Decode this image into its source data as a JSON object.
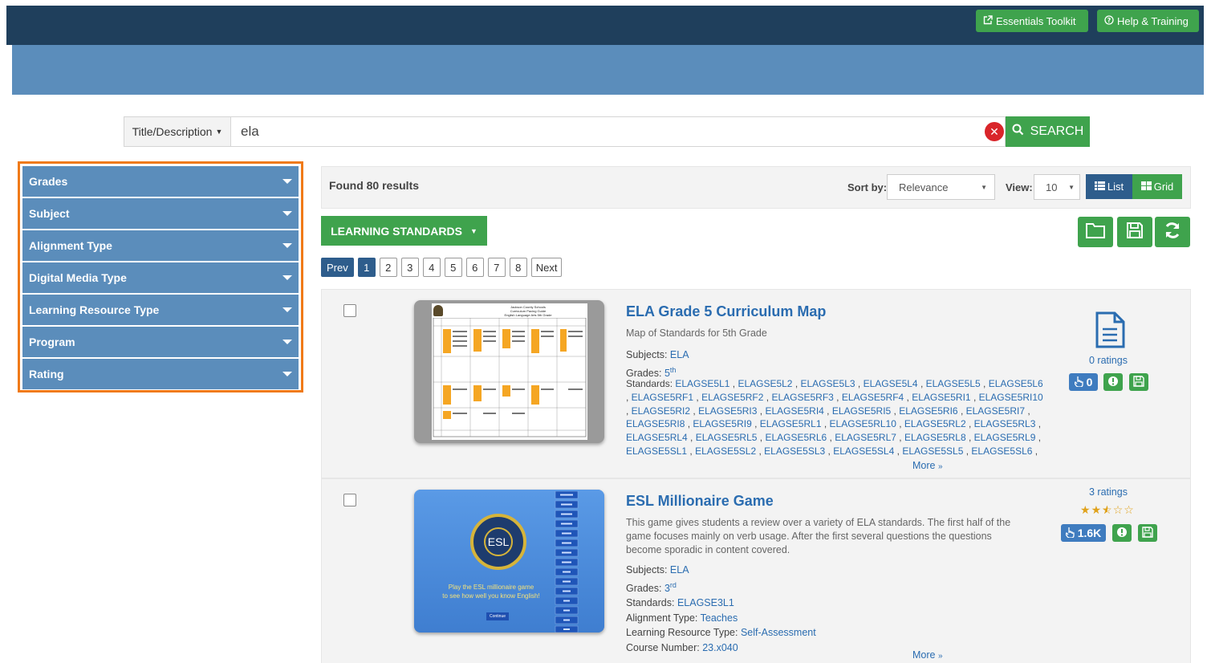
{
  "topbar": {
    "essentials_label": "Essentials Toolkit",
    "help_label": "Help & Training"
  },
  "search": {
    "field_label": "Title/Description",
    "query": "ela",
    "button_label": "SEARCH"
  },
  "filters": [
    "Grades",
    "Subject",
    "Alignment Type",
    "Digital Media Type",
    "Learning Resource Type",
    "Program",
    "Rating"
  ],
  "results": {
    "found_label": "Found 80 results",
    "sort_label": "Sort by:",
    "sort_value": "Relevance",
    "view_label": "View:",
    "view_value": "10",
    "list_label": "List",
    "grid_label": "Grid",
    "standards_button": "LEARNING STANDARDS"
  },
  "pagination": {
    "prev": "Prev",
    "pages": [
      "1",
      "2",
      "3",
      "4",
      "5",
      "6",
      "7",
      "8"
    ],
    "active": "1",
    "next": "Next"
  },
  "items": [
    {
      "title": "ELA Grade 5 Curriculum Map",
      "description": "Map of Standards for 5th Grade",
      "subjects_label": "Subjects:",
      "subjects": "ELA",
      "grades_label": "Grades:",
      "grade_num": "5",
      "grade_sup": "th",
      "standards_label": "Standards:",
      "standards": [
        "ELAGSE5L1",
        "ELAGSE5L2",
        "ELAGSE5L3",
        "ELAGSE5L4",
        "ELAGSE5L5",
        "ELAGSE5L6",
        "ELAGSE5RF1",
        "ELAGSE5RF2",
        "ELAGSE5RF3",
        "ELAGSE5RF4",
        "ELAGSE5RI1",
        "ELAGSE5RI10",
        "ELAGSE5RI2",
        "ELAGSE5RI3",
        "ELAGSE5RI4",
        "ELAGSE5RI5",
        "ELAGSE5RI6",
        "ELAGSE5RI7",
        "ELAGSE5RI8",
        "ELAGSE5RI9",
        "ELAGSE5RL1",
        "ELAGSE5RL10",
        "ELAGSE5RL2",
        "ELAGSE5RL3",
        "ELAGSE5RL4",
        "ELAGSE5RL5",
        "ELAGSE5RL6",
        "ELAGSE5RL7",
        "ELAGSE5RL8",
        "ELAGSE5RL9",
        "ELAGSE5SL1",
        "ELAGSE5SL2",
        "ELAGSE5SL3",
        "ELAGSE5SL4",
        "ELAGSE5SL5",
        "ELAGSE5SL6"
      ],
      "more_label": "More",
      "ratings_label": "0 ratings",
      "views": "0",
      "thumbnail_header": [
        "Jackson County Schools",
        "Curriculum Pacing Guide",
        "English Language Arts 5th Grade"
      ]
    },
    {
      "title": "ESL Millionaire Game",
      "description": [
        "This game gives students a review over a variety of ELA standards. The first half of the",
        "game focuses mainly on verb usage. After the first several questions the questions",
        "become sporadic in content covered."
      ],
      "subjects_label": "Subjects:",
      "subjects": "ELA",
      "grades_label": "Grades:",
      "grade_num": "3",
      "grade_sup": "rd",
      "standards_label": "Standards:",
      "standards": "ELAGSE3L1",
      "alignment_label": "Alignment Type:",
      "alignment": "Teaches",
      "lrt_label": "Learning Resource Type:",
      "lrt": "Self-Assessment",
      "course_label": "Course Number:",
      "course": "23.x040",
      "more_label": "More",
      "ratings_label": "3 ratings",
      "rating_value": 2.5,
      "rating_max": 5,
      "views": "1.6K",
      "thumbnail_logo": "ESL",
      "thumbnail_caption": [
        "Play the ESL millionaire game",
        "to see how well you know English!"
      ],
      "thumbnail_button": "Continue"
    }
  ]
}
